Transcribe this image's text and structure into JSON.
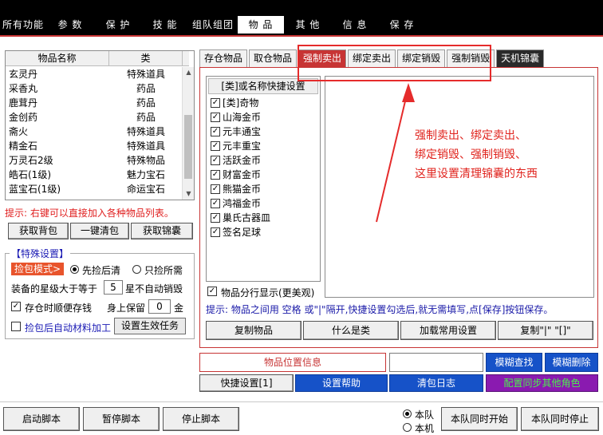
{
  "menu": [
    "所有功能",
    "参 数",
    "保 护",
    "技 能",
    "组队组团",
    "物 品",
    "其 他",
    "信 息",
    "保 存"
  ],
  "item_list": {
    "headers": [
      "物品名称",
      "类"
    ],
    "rows": [
      [
        "玄灵丹",
        "特殊道具"
      ],
      [
        "采香丸",
        "药品"
      ],
      [
        "鹿茸丹",
        "药品"
      ],
      [
        "金创药",
        "药品"
      ],
      [
        "斋火",
        "特殊道具"
      ],
      [
        "精金石",
        "特殊道具"
      ],
      [
        "万灵石2级",
        "特殊物品"
      ],
      [
        "皓石(1级)",
        "魅力宝石"
      ],
      [
        "蓝宝石(1级)",
        "命运宝石"
      ]
    ]
  },
  "hint_left": "提示: 右键可以直接加入各种物品列表。",
  "left_buttons": [
    "获取背包",
    "一键清包",
    "获取锦囊"
  ],
  "special": {
    "legend": "【特殊设置】",
    "pick_mode_label": "捡包模式>",
    "pick_options": [
      "先捡后清",
      "只捡所需"
    ],
    "star_label_pre": "装备的星级大于等于",
    "star_value": "5",
    "star_label_post": "星不自动销毁",
    "deposit_label": "存仓时顺便存钱",
    "keep_label": "身上保留",
    "keep_value": "0",
    "keep_unit": "金",
    "process_label": "捡包后自动材料加工",
    "task_button": "设置生效任务"
  },
  "tabs": [
    "存仓物品",
    "取仓物品",
    "强制卖出",
    "绑定卖出",
    "绑定销毁",
    "强制销毁",
    "天机锦囊"
  ],
  "category_header": "[类]或名称快捷设置",
  "categories": [
    "[类]奇物",
    "山海金币",
    "元丰通宝",
    "元丰重宝",
    "活跃金币",
    "财富金币",
    "熊猫金币",
    "鸿福金币",
    "巢氏古器皿",
    "签名足球"
  ],
  "split_display_label": "物品分行显示(更美观)",
  "annotation": [
    "强制卖出、绑定卖出、",
    "绑定销毁、强制销毁、",
    "这里设置清理锦囊的东西"
  ],
  "hint_right": "提示: 物品之间用 空格 或\"|\"隔开,快捷设置勾选后,就无需填写,点[保存]按钮保存。",
  "right_buttons": [
    "复制物品",
    "什么是类",
    "加载常用设置",
    "复制\"|\" \"[]\""
  ],
  "location": {
    "field_label": "物品位置信息",
    "search_button": "模糊查找",
    "delete_button": "模糊删除"
  },
  "bar_buttons": {
    "quick": "快捷设置[1]",
    "help": "设置帮助",
    "log": "清包日志",
    "sync": "配置同步其他角色"
  },
  "bottom": {
    "start": "启动脚本",
    "pause": "暂停脚本",
    "stop": "停止脚本",
    "radio_team": "本队",
    "radio_machine": "本机",
    "team_start": "本队同时开始",
    "team_stop": "本队同时停止"
  },
  "colors": {
    "accent": "#c73434",
    "annotation": "#e0241e",
    "blue": "#1652c8",
    "purple": "#8a1ab0"
  }
}
